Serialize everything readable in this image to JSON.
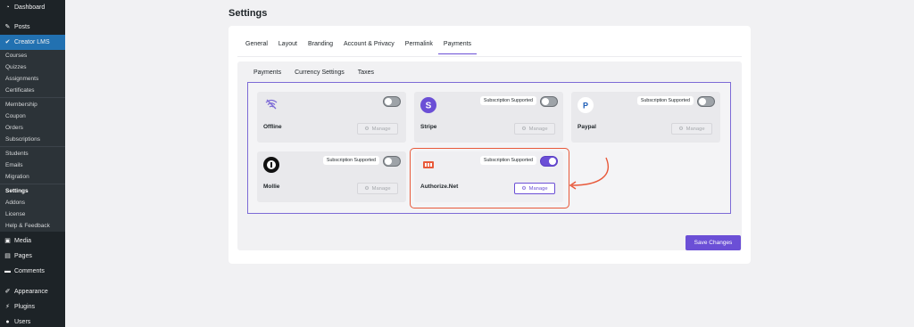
{
  "sidebar": {
    "top_items": [
      {
        "label": "Dashboard",
        "icon": "dashboard-icon"
      },
      {
        "label": "Posts",
        "icon": "pin-icon"
      },
      {
        "label": "Creator LMS",
        "icon": "lms-icon"
      }
    ],
    "sub_items": [
      "Courses",
      "Quizzes",
      "Assignments",
      "Certificates",
      "Membership",
      "Coupon",
      "Orders",
      "Subscriptions",
      "Students",
      "Emails",
      "Migration",
      "Settings",
      "Addons",
      "License",
      "Help & Feedback"
    ],
    "bottom_items": [
      {
        "label": "Media",
        "icon": "media-icon"
      },
      {
        "label": "Pages",
        "icon": "pages-icon"
      },
      {
        "label": "Comments",
        "icon": "comments-icon"
      },
      {
        "label": "Appearance",
        "icon": "appearance-icon"
      },
      {
        "label": "Plugins",
        "icon": "plugins-icon"
      },
      {
        "label": "Users",
        "icon": "users-icon"
      }
    ]
  },
  "page": {
    "title": "Settings"
  },
  "tabs": [
    "General",
    "Layout",
    "Branding",
    "Account & Privacy",
    "Permalink",
    "Payments"
  ],
  "subtabs": [
    "Payments",
    "Currency Settings",
    "Taxes"
  ],
  "gateways": [
    {
      "name": "Offline",
      "badge": "",
      "enabled": false,
      "manage": "Manage"
    },
    {
      "name": "Stripe",
      "badge": "Subscription Supported",
      "enabled": false,
      "manage": "Manage"
    },
    {
      "name": "Paypal",
      "badge": "Subscription Supported",
      "enabled": false,
      "manage": "Manage"
    },
    {
      "name": "Mollie",
      "badge": "Subscription Supported",
      "enabled": false,
      "manage": "Manage"
    },
    {
      "name": "Authorize.Net",
      "badge": "Subscription Supported",
      "enabled": true,
      "manage": "Manage"
    }
  ],
  "save_label": "Save Changes",
  "colors": {
    "accent": "#6b4fd6",
    "annotation": "#e8593a",
    "wp_blue": "#2271b1"
  }
}
